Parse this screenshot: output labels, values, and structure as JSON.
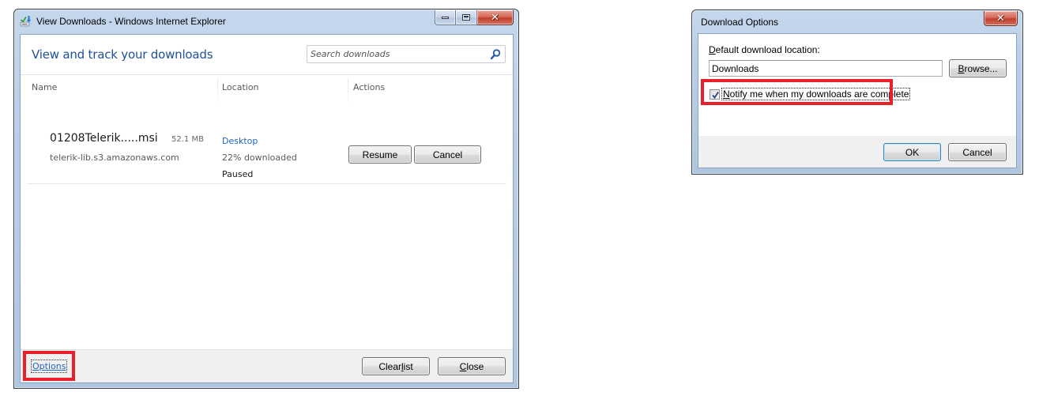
{
  "downloads_window": {
    "title": "View Downloads - Windows Internet Explorer",
    "heading": "View and track your downloads",
    "search": {
      "placeholder": "Search downloads",
      "value": ""
    },
    "columns": [
      "Name",
      "Location",
      "Actions"
    ],
    "items": [
      {
        "file_name": "01208Telerik.....msi",
        "size": "52.1 MB",
        "source": "telerik-lib.s3.amazonaws.com",
        "location": "Desktop",
        "progress_text": "22% downloaded",
        "progress_percent": 22,
        "status": "Paused",
        "actions": {
          "resume": "Resume",
          "cancel": "Cancel"
        }
      }
    ],
    "footer": {
      "options_link": "Options",
      "clear_list": {
        "pre": "Clear ",
        "accel": "l",
        "post": "ist"
      },
      "close": {
        "pre": "",
        "accel": "C",
        "post": "lose"
      }
    }
  },
  "options_dialog": {
    "title": "Download Options",
    "location_label": {
      "pre": "",
      "accel": "D",
      "post": "efault download location:"
    },
    "location_value": "Downloads",
    "browse": {
      "pre": "",
      "accel": "B",
      "post": "rowse..."
    },
    "notify": {
      "pre": "",
      "accel": "N",
      "post": "otify me when my downloads are complete",
      "checked": true
    },
    "ok": "OK",
    "cancel": "Cancel"
  },
  "annotations": {
    "highlight_color": "#e8202a",
    "highlighted": [
      "options-link",
      "notify-checkbox"
    ]
  },
  "colors": {
    "heading_blue": "#1e4f9c",
    "link_blue": "#1f66c2",
    "close_red": "#c13f2b"
  }
}
